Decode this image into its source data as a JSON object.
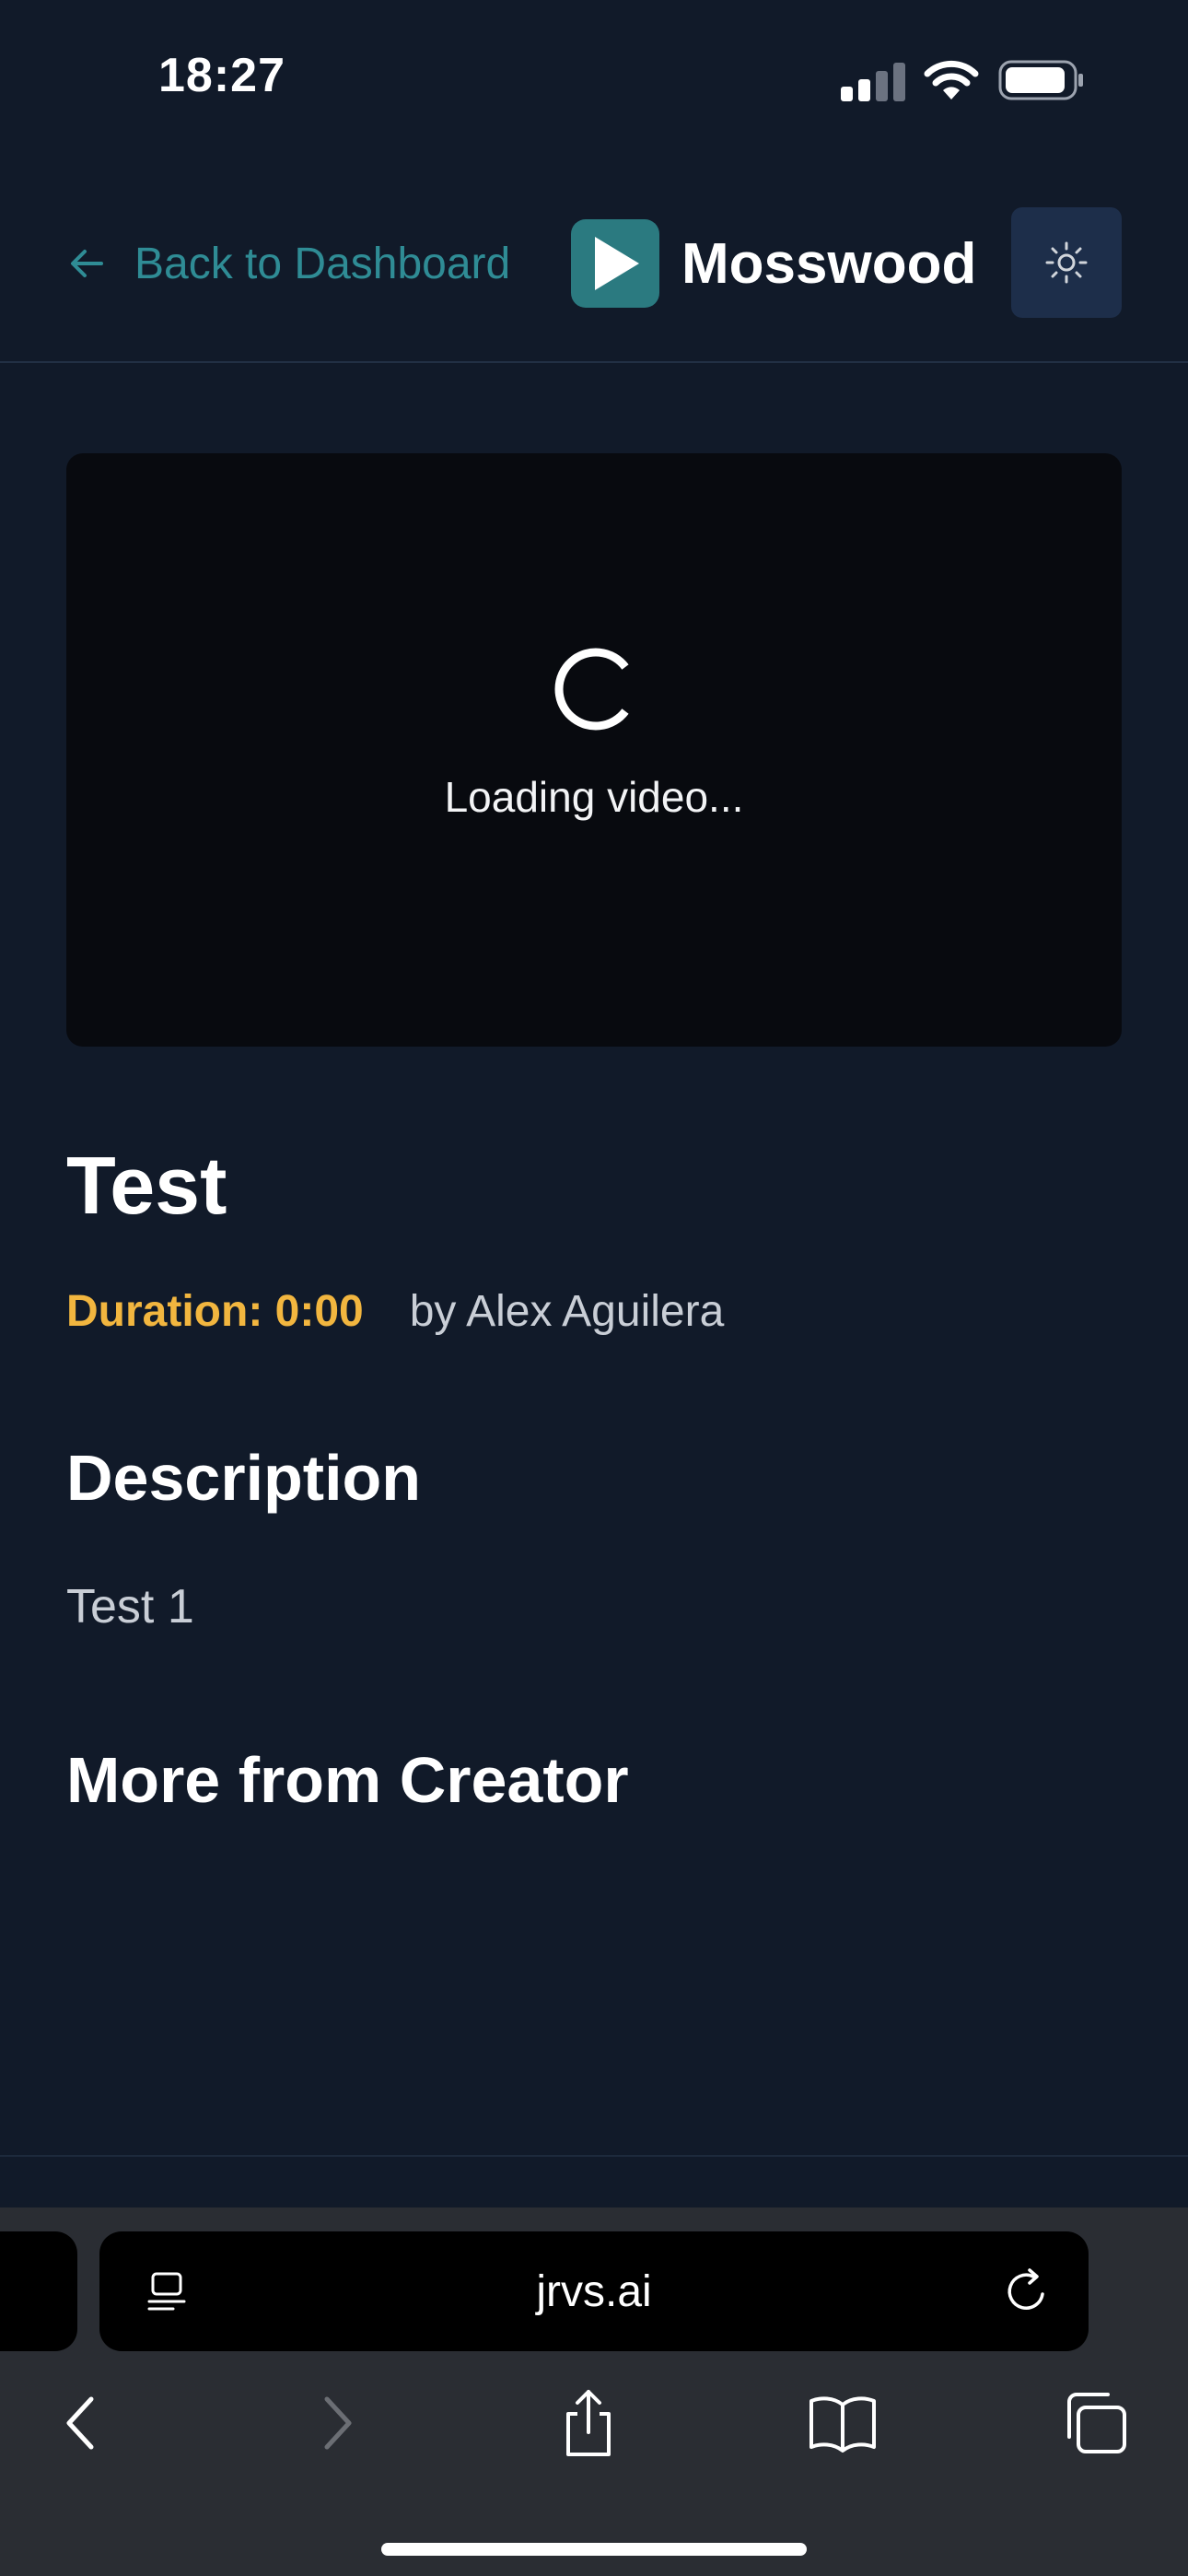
{
  "status_bar": {
    "time": "18:27"
  },
  "header": {
    "back_label": "Back to Dashboard",
    "brand": "Mosswood",
    "accent_color": "#2f8c95",
    "logo_color": "#2b7a80"
  },
  "player": {
    "loading_text": "Loading video..."
  },
  "video": {
    "title": "Test",
    "duration": "Duration: 0:00",
    "author": "by Alex Aguilera",
    "duration_color": "#f2b63f"
  },
  "description": {
    "heading": "Description",
    "body": "Test 1"
  },
  "more": {
    "heading": "More from Creator"
  },
  "browser": {
    "url": "jrvs.ai",
    "icons": [
      "reader-icon",
      "reload-icon",
      "back-arrow-icon",
      "forward-arrow-icon",
      "share-icon",
      "bookmarks-icon",
      "tabs-icon"
    ]
  }
}
